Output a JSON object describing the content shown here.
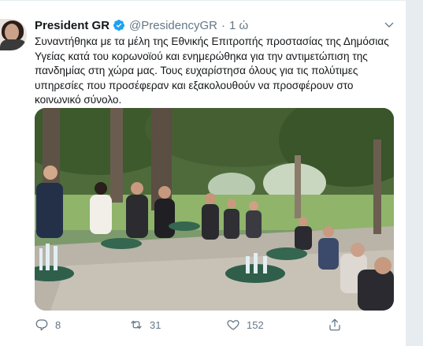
{
  "tweet": {
    "display_name": "President GR",
    "handle": "@PresidencyGR",
    "separator": "·",
    "time": "1 ώ",
    "text": "Συναντήθηκα με τα μέλη της Εθνικής Επιτροπής προστασίας της Δημόσιας Υγείας κατά του κορωνοϊού και ενημερώθηκα για την αντιμετώπιση της πανδημίας στη χώρα μας. Τους ευχαρίστησα όλους για τις πολύτιμες υπηρεσίες που προσέφεραν και εξακολουθούν να προσφέρουν στο κοινωνικό σύνολο.",
    "verified": true
  },
  "actions": {
    "reply_count": "8",
    "retweet_count": "31",
    "like_count": "152"
  },
  "icons": {
    "verified": "verified-badge-icon",
    "caret": "chevron-down-icon",
    "reply": "reply-icon",
    "retweet": "retweet-icon",
    "like": "heart-icon",
    "share": "share-icon"
  },
  "colors": {
    "verified": "#1da1f2",
    "text_secondary": "#657786",
    "text_primary": "#14171a"
  }
}
